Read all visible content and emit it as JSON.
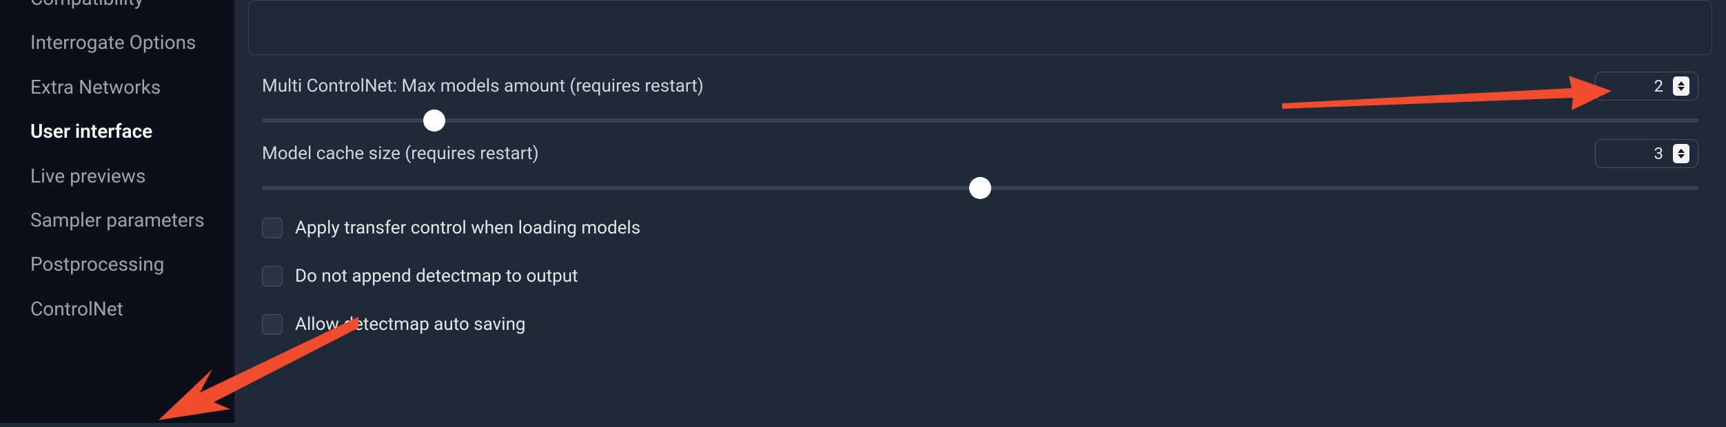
{
  "sidebar": {
    "items": [
      {
        "label": "Compatibility"
      },
      {
        "label": "Interrogate Options"
      },
      {
        "label": "Extra Networks"
      },
      {
        "label": "User interface"
      },
      {
        "label": "Live previews"
      },
      {
        "label": "Sampler parameters"
      },
      {
        "label": "Postprocessing"
      },
      {
        "label": "ControlNet"
      }
    ],
    "active_index": 3
  },
  "settings": {
    "multi_controlnet": {
      "label": "Multi ControlNet: Max models amount (requires restart)",
      "value": "2",
      "slider_percent": 12
    },
    "model_cache": {
      "label": "Model cache size (requires restart)",
      "value": "3",
      "slider_percent": 50
    },
    "checkboxes": [
      {
        "label": "Apply transfer control when loading models",
        "checked": false
      },
      {
        "label": "Do not append detectmap to output",
        "checked": false
      },
      {
        "label": "Allow detectmap auto saving",
        "checked": false
      }
    ]
  },
  "colors": {
    "arrow": "#f04d2f"
  }
}
